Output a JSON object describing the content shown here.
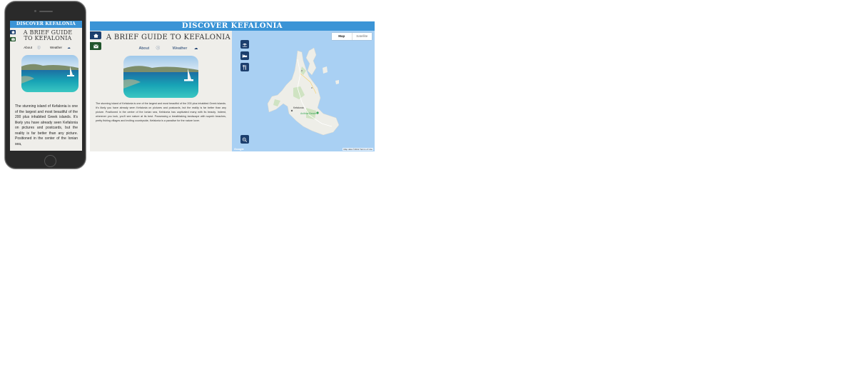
{
  "brand": {
    "title": "DISCOVER KEFALONIA",
    "header_color": "#3b94d6",
    "nav_dark": "#1c3f6e",
    "nav_green": "#21552c"
  },
  "sidebar": {
    "items": [
      {
        "icon": "home-icon"
      },
      {
        "icon": "envelope-icon"
      }
    ]
  },
  "guide": {
    "title": "A BRIEF GUIDE TO KEFALONIA",
    "mobile_title_line1": "A BRIEF GUIDE",
    "mobile_title_line2": "TO KEFALONIA",
    "link_about": "About",
    "link_weather": "Weather",
    "body_mobile": "The stunning island of Kefalonia is one of the largest and most beautiful of the 200 plus inhabited Greek islands. It's likely you have already seen Kefalonia on pictures and postcards, but the reality is far better than any picture. Positioned in the center of the Ionian sea,",
    "body_desktop": "The stunning island of Kefalonia is one of the largest and most beautiful of the 200 plus inhabited Greek islands. It's likely you have already seen Kefalonia on pictures and postcards, but the reality is far better than any picture. Positioned in the center of the Ionian sea, Kefalonia has captivated many with its beauty. Indeed, wherever you look, you'll see nature at its best. Possessing a breathtaking landscape with superb beaches, pretty fishing villages and inviting countryside, Kefalonia is a paradise for the nature lover."
  },
  "map": {
    "toggle_map": "Map",
    "toggle_satellite": "Satellite",
    "controls": [
      {
        "icon": "beach-icon"
      },
      {
        "icon": "hotel-icon"
      },
      {
        "icon": "restaurant-icon"
      }
    ],
    "zoom_icon": "zoom-out-icon",
    "label_town": "Kefalonia",
    "label_poi": "Avithos Beach",
    "attribution": "Map data ©2022   Terms of Use",
    "logo": "Google",
    "water_color": "#a9d0f3",
    "land_color": "#eeeee8"
  }
}
